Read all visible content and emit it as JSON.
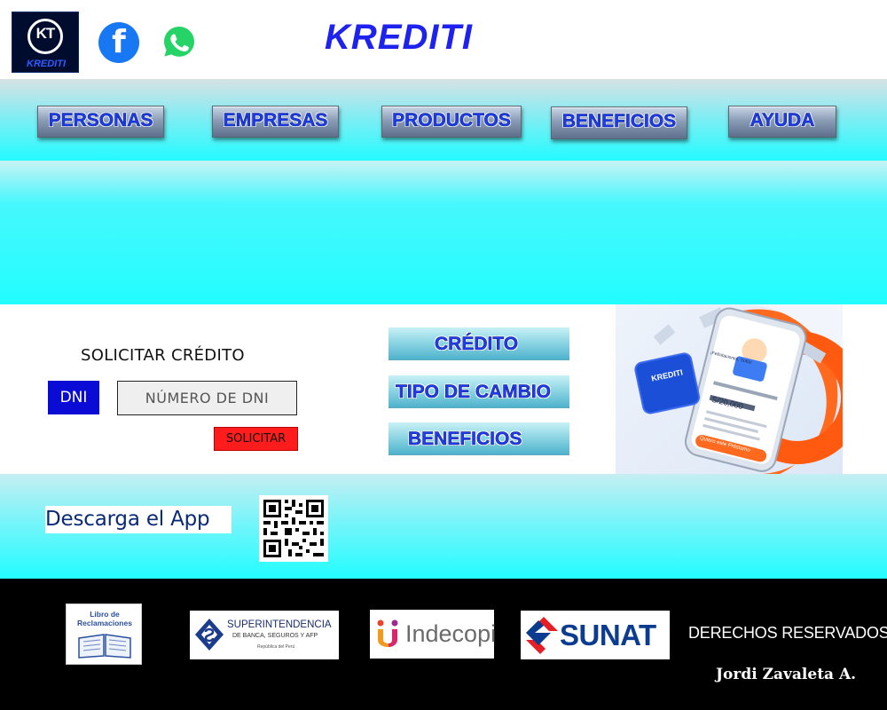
{
  "header": {
    "logo_text": "KT",
    "logo_caption": "KREDITI",
    "facebook_glyph": "f",
    "brand_title": "KREDITI",
    "icons": [
      "facebook-icon",
      "whatsapp-icon"
    ]
  },
  "nav": {
    "items": [
      {
        "label": "PERSONAS"
      },
      {
        "label": "EMPRESAS"
      },
      {
        "label": "PRODUCTOS"
      },
      {
        "label": "BENEFICIOS"
      },
      {
        "label": "AYUDA"
      }
    ]
  },
  "credit_form": {
    "title": "SOLICITAR CRÉDITO",
    "doc_type": "DNI",
    "dni_placeholder": "NÚMERO DE DNI",
    "submit_label": "SOLICITAR"
  },
  "side_links": [
    {
      "label": "CRÉDITO"
    },
    {
      "label": "TIPO DE CAMBIO"
    },
    {
      "label": "BENEFICIOS"
    }
  ],
  "promo": {
    "card_text": "KREDITI",
    "phone_heading": "¡Felicitaciones, Sofía!",
    "phone_amount": "S/20,000",
    "cta": "Quiero este Préstamo"
  },
  "app": {
    "label": "Descarga el App"
  },
  "footer": {
    "reclamaciones_line1": "Libro de",
    "reclamaciones_line2": "Reclamaciones",
    "sbs_line1": "SUPERINTENDENCIA",
    "sbs_line2": "DE BANCA, SEGUROS Y AFP",
    "sbs_line3": "República del Perú",
    "indecopi": "Indecopi",
    "sunat": "SUNAT",
    "rights": "DERECHOS RESERVADOS",
    "author": "Jordi Zavaleta A."
  },
  "colors": {
    "brand_blue": "#1e22ee",
    "cyan": "#22fdff",
    "dni_blue": "#0b0bd6",
    "submit_red": "#ff1c1c",
    "footer_bg": "#000000"
  }
}
